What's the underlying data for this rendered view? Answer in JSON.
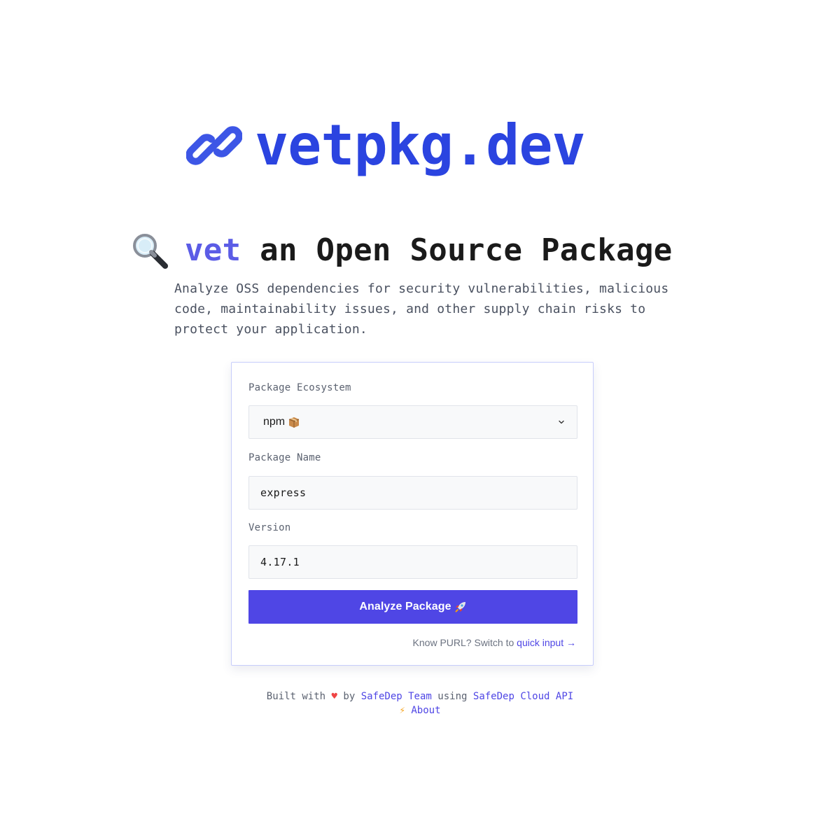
{
  "site": {
    "logo_icon": "link-icon",
    "logo_text": "vetpkg.dev",
    "accent_color": "#2b44e0"
  },
  "hero": {
    "icon": "magnifying-glass-icon",
    "title_accent": "vet",
    "title_rest": " an Open Source Package",
    "tagline": "Analyze OSS dependencies for security vulnerabilities, malicious code, maintainability issues, and other supply chain risks to protect your application."
  },
  "form": {
    "ecosystem_label": "Package Ecosystem",
    "ecosystem_value": "npm",
    "ecosystem_icon": "package-box-icon",
    "name_label": "Package Name",
    "name_value": "express",
    "version_label": "Version",
    "version_value": "4.17.1",
    "submit_label": "Analyze Package",
    "submit_icon": "rocket-icon",
    "submit_color": "#4f46e5",
    "purl_prompt": "Know PURL? Switch to ",
    "purl_link": "quick input →"
  },
  "footer": {
    "built_with": "Built with",
    "heart": "♥",
    "by": "by",
    "team_link": "SafeDep Team",
    "using": "using",
    "api_link": "SafeDep Cloud API",
    "bolt": "⚡",
    "about_link": "About"
  }
}
